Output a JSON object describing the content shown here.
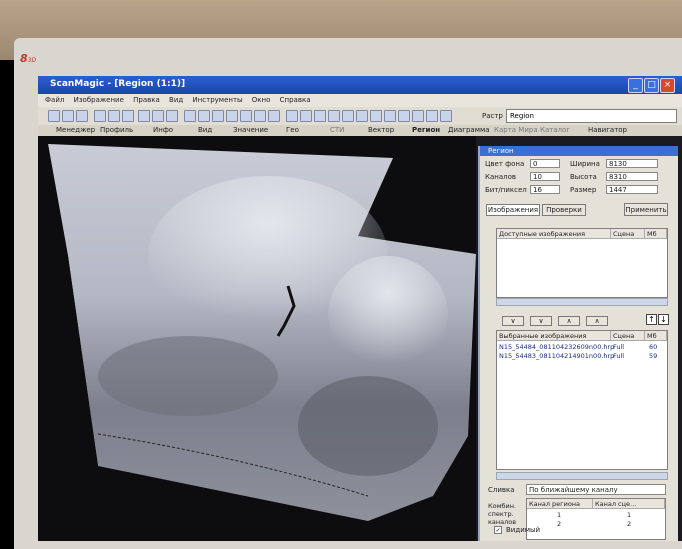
{
  "device": {
    "logo": "8",
    "logo_sub": "3D"
  },
  "window": {
    "title": "ScanMagic - [Region (1:1)]"
  },
  "menu": [
    "Файл",
    "Изображение",
    "Правка",
    "Вид",
    "Инструменты",
    "Окно",
    "Справка"
  ],
  "toolbar": {
    "raster_label": "Растр",
    "raster_value": "Region"
  },
  "tabs": [
    "Менеджер",
    "Профиль",
    "Инфо",
    "Вид",
    "Значение",
    "Гео",
    "СТИ",
    "Вектор",
    "Регион",
    "Диаграмма",
    "Карта Мира",
    "Каталог",
    "Навигатор"
  ],
  "region_panel": {
    "title": "Регион",
    "fields": [
      {
        "label": "Цвет фона",
        "value": "0"
      },
      {
        "label": "Каналов",
        "value": "10"
      },
      {
        "label": "Бит/пиксел",
        "value": "16"
      }
    ],
    "dims": [
      {
        "label": "Ширина",
        "value": "8130"
      },
      {
        "label": "Высота",
        "value": "8310"
      },
      {
        "label": "Размер",
        "value": "1447"
      }
    ],
    "tab_images": "Изображения",
    "tab_check": "Проверки",
    "apply_button": "Применить",
    "available": {
      "header": "Доступные изображения",
      "col2": "Сцена",
      "col3": "Мб"
    },
    "selected": {
      "header": "Выбранные изображения",
      "col2": "Сцена",
      "col3": "Мб",
      "rows": [
        {
          "name": "N15_54484_081104232609n00.hrp",
          "scene": "Full",
          "mb": "60"
        },
        {
          "name": "N15_54483_081104214901n00.hrp",
          "scene": "Full",
          "mb": "59"
        }
      ]
    },
    "stitch_label": "Сливка",
    "stitch_value": "По ближайшему каналу",
    "combo_label": "Комбин. спектр. каналов",
    "channel_table": {
      "col1": "Канал региона",
      "col2": "Канал сце...",
      "rows": [
        [
          "1",
          "1"
        ],
        [
          "2",
          "2"
        ]
      ]
    },
    "checkbox_label": "Видимый"
  }
}
